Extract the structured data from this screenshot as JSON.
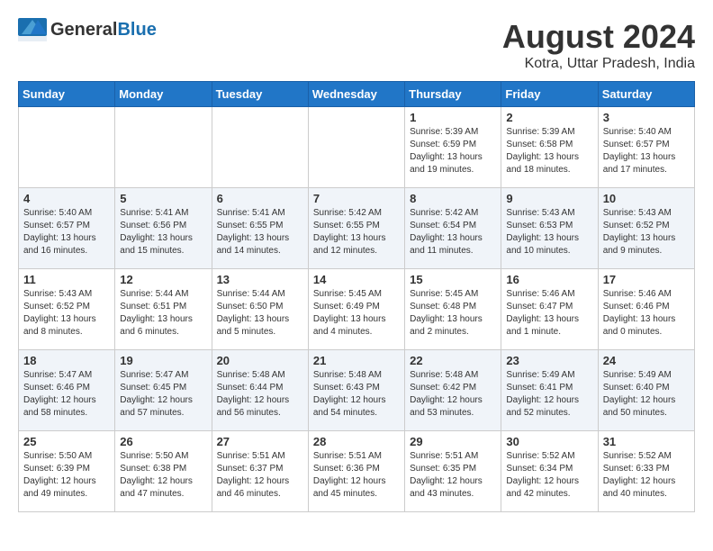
{
  "header": {
    "logo_general": "General",
    "logo_blue": "Blue",
    "month_year": "August 2024",
    "location": "Kotra, Uttar Pradesh, India"
  },
  "days_of_week": [
    "Sunday",
    "Monday",
    "Tuesday",
    "Wednesday",
    "Thursday",
    "Friday",
    "Saturday"
  ],
  "weeks": [
    [
      {
        "day": "",
        "info": ""
      },
      {
        "day": "",
        "info": ""
      },
      {
        "day": "",
        "info": ""
      },
      {
        "day": "",
        "info": ""
      },
      {
        "day": "1",
        "info": "Sunrise: 5:39 AM\nSunset: 6:59 PM\nDaylight: 13 hours\nand 19 minutes."
      },
      {
        "day": "2",
        "info": "Sunrise: 5:39 AM\nSunset: 6:58 PM\nDaylight: 13 hours\nand 18 minutes."
      },
      {
        "day": "3",
        "info": "Sunrise: 5:40 AM\nSunset: 6:57 PM\nDaylight: 13 hours\nand 17 minutes."
      }
    ],
    [
      {
        "day": "4",
        "info": "Sunrise: 5:40 AM\nSunset: 6:57 PM\nDaylight: 13 hours\nand 16 minutes."
      },
      {
        "day": "5",
        "info": "Sunrise: 5:41 AM\nSunset: 6:56 PM\nDaylight: 13 hours\nand 15 minutes."
      },
      {
        "day": "6",
        "info": "Sunrise: 5:41 AM\nSunset: 6:55 PM\nDaylight: 13 hours\nand 14 minutes."
      },
      {
        "day": "7",
        "info": "Sunrise: 5:42 AM\nSunset: 6:55 PM\nDaylight: 13 hours\nand 12 minutes."
      },
      {
        "day": "8",
        "info": "Sunrise: 5:42 AM\nSunset: 6:54 PM\nDaylight: 13 hours\nand 11 minutes."
      },
      {
        "day": "9",
        "info": "Sunrise: 5:43 AM\nSunset: 6:53 PM\nDaylight: 13 hours\nand 10 minutes."
      },
      {
        "day": "10",
        "info": "Sunrise: 5:43 AM\nSunset: 6:52 PM\nDaylight: 13 hours\nand 9 minutes."
      }
    ],
    [
      {
        "day": "11",
        "info": "Sunrise: 5:43 AM\nSunset: 6:52 PM\nDaylight: 13 hours\nand 8 minutes."
      },
      {
        "day": "12",
        "info": "Sunrise: 5:44 AM\nSunset: 6:51 PM\nDaylight: 13 hours\nand 6 minutes."
      },
      {
        "day": "13",
        "info": "Sunrise: 5:44 AM\nSunset: 6:50 PM\nDaylight: 13 hours\nand 5 minutes."
      },
      {
        "day": "14",
        "info": "Sunrise: 5:45 AM\nSunset: 6:49 PM\nDaylight: 13 hours\nand 4 minutes."
      },
      {
        "day": "15",
        "info": "Sunrise: 5:45 AM\nSunset: 6:48 PM\nDaylight: 13 hours\nand 2 minutes."
      },
      {
        "day": "16",
        "info": "Sunrise: 5:46 AM\nSunset: 6:47 PM\nDaylight: 13 hours\nand 1 minute."
      },
      {
        "day": "17",
        "info": "Sunrise: 5:46 AM\nSunset: 6:46 PM\nDaylight: 13 hours\nand 0 minutes."
      }
    ],
    [
      {
        "day": "18",
        "info": "Sunrise: 5:47 AM\nSunset: 6:46 PM\nDaylight: 12 hours\nand 58 minutes."
      },
      {
        "day": "19",
        "info": "Sunrise: 5:47 AM\nSunset: 6:45 PM\nDaylight: 12 hours\nand 57 minutes."
      },
      {
        "day": "20",
        "info": "Sunrise: 5:48 AM\nSunset: 6:44 PM\nDaylight: 12 hours\nand 56 minutes."
      },
      {
        "day": "21",
        "info": "Sunrise: 5:48 AM\nSunset: 6:43 PM\nDaylight: 12 hours\nand 54 minutes."
      },
      {
        "day": "22",
        "info": "Sunrise: 5:48 AM\nSunset: 6:42 PM\nDaylight: 12 hours\nand 53 minutes."
      },
      {
        "day": "23",
        "info": "Sunrise: 5:49 AM\nSunset: 6:41 PM\nDaylight: 12 hours\nand 52 minutes."
      },
      {
        "day": "24",
        "info": "Sunrise: 5:49 AM\nSunset: 6:40 PM\nDaylight: 12 hours\nand 50 minutes."
      }
    ],
    [
      {
        "day": "25",
        "info": "Sunrise: 5:50 AM\nSunset: 6:39 PM\nDaylight: 12 hours\nand 49 minutes."
      },
      {
        "day": "26",
        "info": "Sunrise: 5:50 AM\nSunset: 6:38 PM\nDaylight: 12 hours\nand 47 minutes."
      },
      {
        "day": "27",
        "info": "Sunrise: 5:51 AM\nSunset: 6:37 PM\nDaylight: 12 hours\nand 46 minutes."
      },
      {
        "day": "28",
        "info": "Sunrise: 5:51 AM\nSunset: 6:36 PM\nDaylight: 12 hours\nand 45 minutes."
      },
      {
        "day": "29",
        "info": "Sunrise: 5:51 AM\nSunset: 6:35 PM\nDaylight: 12 hours\nand 43 minutes."
      },
      {
        "day": "30",
        "info": "Sunrise: 5:52 AM\nSunset: 6:34 PM\nDaylight: 12 hours\nand 42 minutes."
      },
      {
        "day": "31",
        "info": "Sunrise: 5:52 AM\nSunset: 6:33 PM\nDaylight: 12 hours\nand 40 minutes."
      }
    ]
  ]
}
